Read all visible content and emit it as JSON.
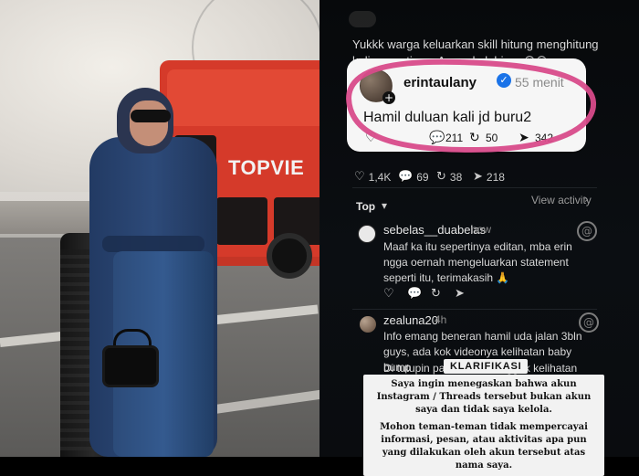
{
  "photo": {
    "bus_ad_text": "TOPVIE"
  },
  "thread": {
    "prev_text": "Yukkk warga keluarkan skill hitung menghitung kalian nanti pas Amanda lahiran",
    "prev_emojis": "😁😂",
    "highlight": {
      "username": "erintaulany",
      "verified": true,
      "time": "55 menit",
      "text": "Hamil duluan kali jd buru2",
      "actions": {
        "comments": "211",
        "reposts": "50",
        "shares": "342"
      }
    },
    "stats": {
      "likes": "1,4K",
      "comments": "69",
      "reposts": "38",
      "shares": "218"
    },
    "sort": {
      "label": "Top",
      "view_activity": "View activity"
    },
    "comments": [
      {
        "username": "sebelas__duabelas",
        "time": "now",
        "text": "Maaf ka itu sepertinya editan, mba erin ngga oernah mengeluarkan statement seperti itu, terimakasih 🙏"
      },
      {
        "username": "zealuna20",
        "time": "4h",
        "text": "Info emang beneran hamil uda jalan 3bln guys, ada kok videonya kelihatan baby bump",
        "partial_left": "Di tutupin pak",
        "partial_right": "nggak kelihatan"
      }
    ]
  },
  "overlay": {
    "label": "KLARIFIKASI",
    "box1": "Saya ingin menegaskan bahwa akun Instagram / Threads tersebut bukan akun saya dan tidak saya kelola.",
    "box2": "Mohon teman-teman tidak mempercayai informasi, pesan, atau aktivitas apa pun yang dilakukan oleh akun tersebut atas nama saya."
  },
  "colors": {
    "pink_circle": "#d84b8a",
    "verified": "#1a73e8"
  },
  "icons": {
    "verified": "verified-icon",
    "threads": "threads-icon"
  }
}
